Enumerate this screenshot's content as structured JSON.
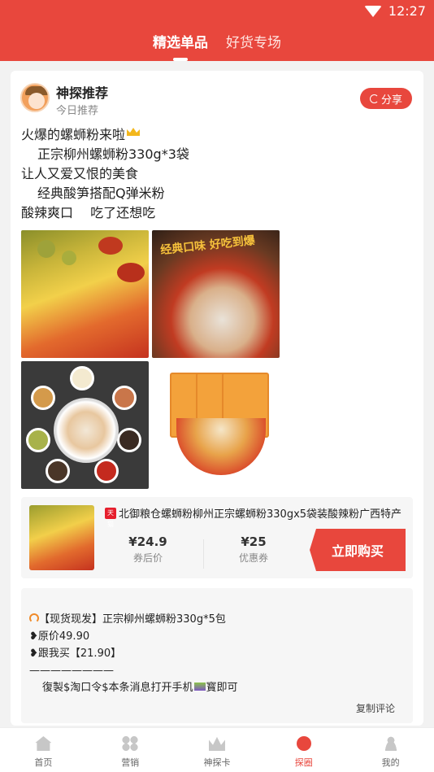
{
  "status": {
    "time": "12:27"
  },
  "tabs": [
    {
      "label": "精选单品",
      "active": true
    },
    {
      "label": "好货专场",
      "active": false
    }
  ],
  "post": {
    "author": "神探推荐",
    "subtitle": "今日推荐",
    "share_label": "分享",
    "lines": [
      "火爆的螺蛳粉来啦",
      "正宗柳州螺蛳粉330g*3袋",
      "让人又爱又恨的美食",
      "经典酸笋搭配Q弹米粉",
      "酸辣爽口　 吃了还想吃"
    ],
    "image2_text": "经典口味 好吃到爆"
  },
  "product": {
    "badge": "天猫",
    "title": "北御粮仓螺蛳粉柳州正宗螺蛳粉330gx5袋装酸辣粉广西特产",
    "price_after": "¥24.9",
    "price_after_label": "券后价",
    "coupon": "¥25",
    "coupon_label": "优惠券",
    "buy_label": "立即购买"
  },
  "comment": {
    "lines": [
      "【现货现发】正宗柳州螺蛳粉330g*5包",
      "❥原价49.90",
      "❥跟我买【21.90】",
      "————————",
      "復製$淘口令$本条消息打开手机",
      "寳即可"
    ],
    "copy_label": "复制评论"
  },
  "tabbar": [
    {
      "label": "首页",
      "icon": "home-icon",
      "active": false
    },
    {
      "label": "营销",
      "icon": "grid-icon",
      "active": false
    },
    {
      "label": "神探卡",
      "icon": "crown-icon",
      "active": false
    },
    {
      "label": "探圈",
      "icon": "circle-icon",
      "active": true
    },
    {
      "label": "我的",
      "icon": "user-icon",
      "active": false
    }
  ],
  "colors": {
    "primary": "#e8473d"
  }
}
